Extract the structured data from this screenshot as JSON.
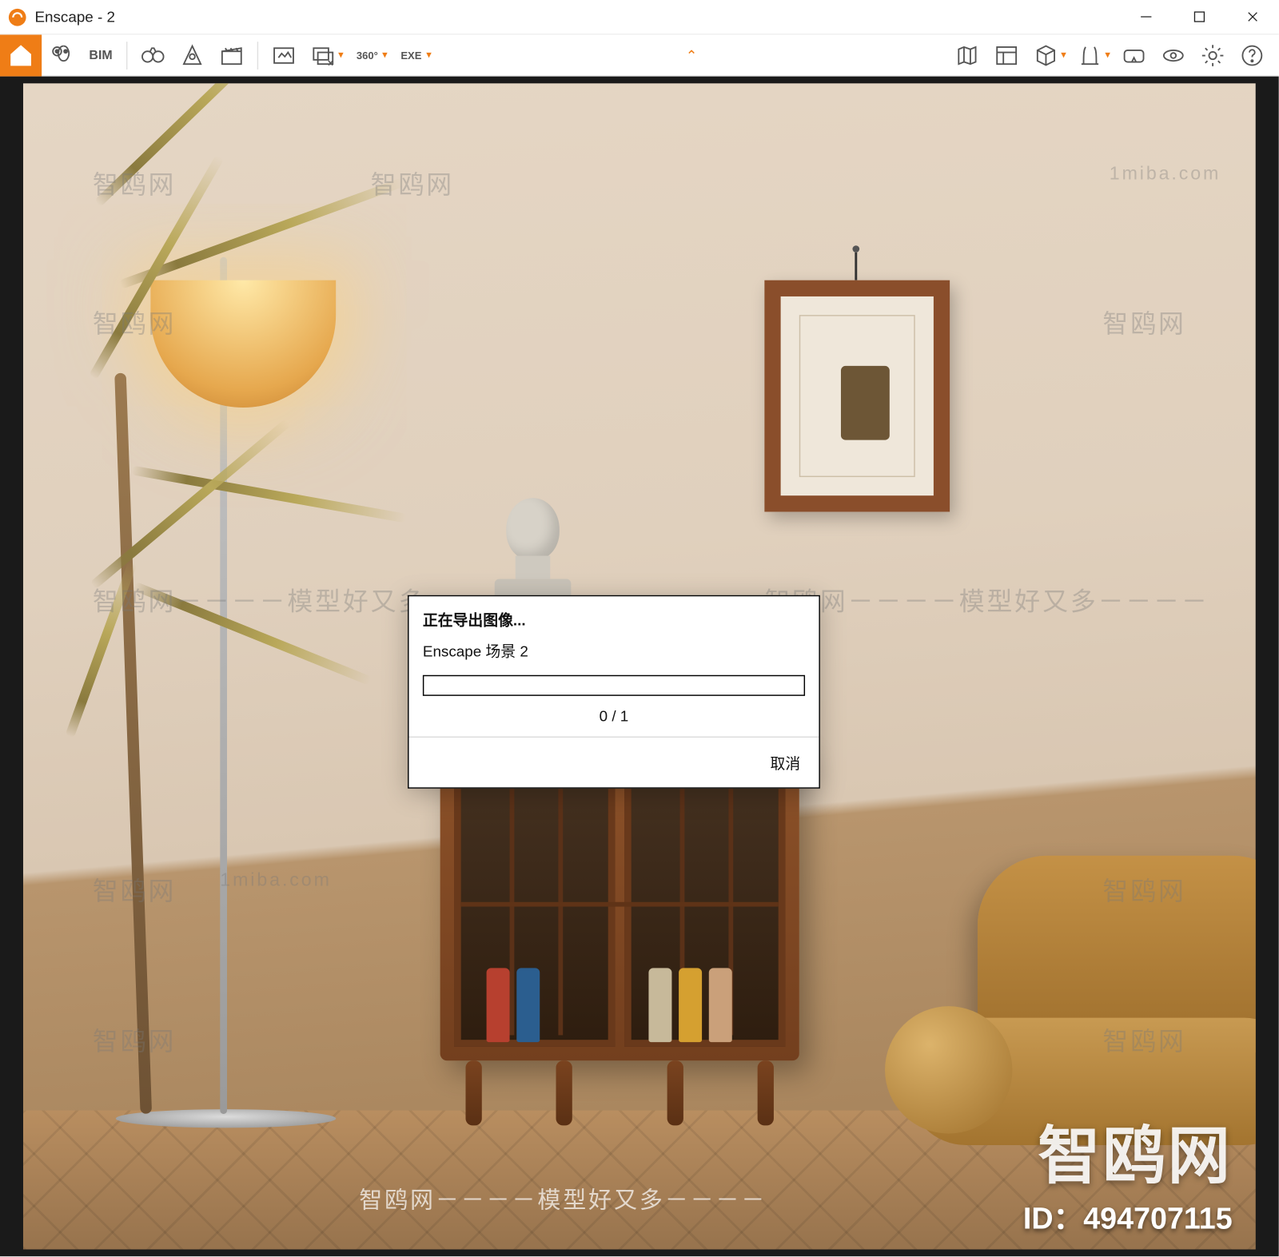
{
  "window": {
    "title": "Enscape - 2"
  },
  "toolbar": {
    "bim_label": "BIM",
    "panorama_label": "360°",
    "exe_label": "EXE"
  },
  "center_chevron": "⌃",
  "dialog": {
    "title": "正在导出图像...",
    "subtitle": "Enscape 场景 2",
    "progress_text": "0 / 1",
    "cancel": "取消"
  },
  "watermarks": {
    "domain": "1miba.com",
    "brand": "智鸥网",
    "tagline": "智鸥网－－－－模型好又多－－－－",
    "big_brand": "智鸥网",
    "id_label": "ID：494707115"
  },
  "colors": {
    "accent": "#ef7d16",
    "titlebar_text": "#222222"
  }
}
